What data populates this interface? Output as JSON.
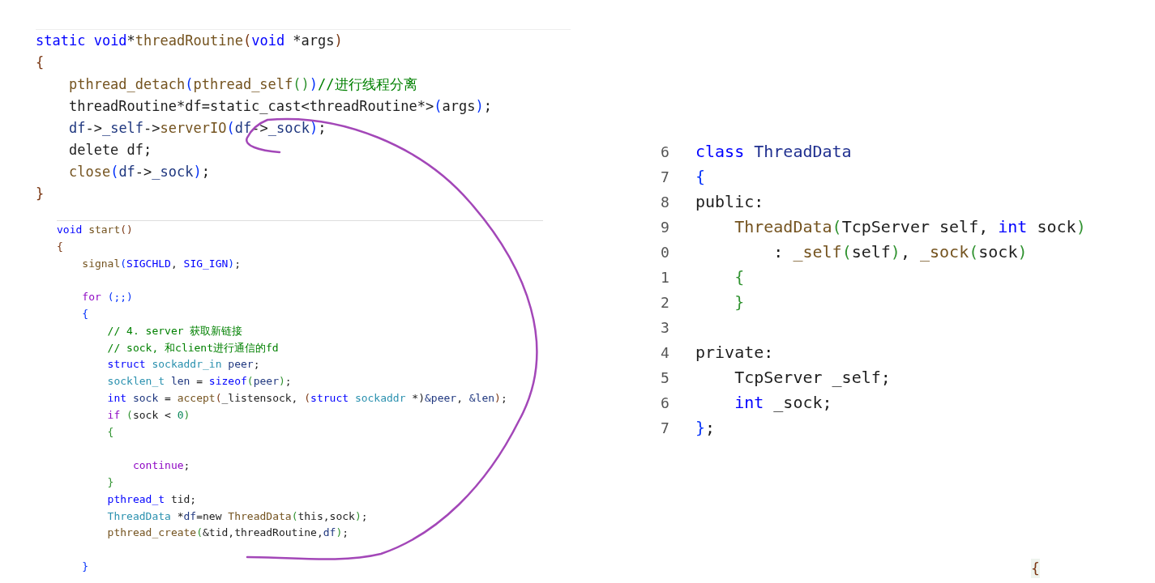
{
  "snippets": [
    {
      "lines": [
        {
          "kind": "code",
          "tokens": [
            {
              "text": "static ",
              "kind": "kw"
            },
            {
              "text": "void",
              "kind": "kw"
            },
            {
              "text": "*",
              "kind": "txt"
            },
            {
              "text": "threadRoutine",
              "kind": "fn"
            },
            {
              "text": "(",
              "kind": "p1"
            },
            {
              "text": "void ",
              "kind": "kw"
            },
            {
              "text": "*args",
              "kind": "txt"
            },
            {
              "text": ")",
              "kind": "p1"
            }
          ]
        },
        {
          "kind": "code",
          "tokens": [
            {
              "text": "{",
              "kind": "p1"
            }
          ]
        },
        {
          "kind": "code",
          "tokens": [
            {
              "text": "    pthread_detach",
              "kind": "fn"
            },
            {
              "text": "(",
              "kind": "p2"
            },
            {
              "text": "pthread_self",
              "kind": "fn"
            },
            {
              "text": "()",
              "kind": "p3"
            },
            {
              "text": ")",
              "kind": "p2"
            },
            {
              "text": "//进行线程分离",
              "kind": "cmt"
            }
          ]
        },
        {
          "kind": "code",
          "tokens": [
            {
              "text": "    threadRoutine*df=static_cast<threadRoutine*>",
              "kind": "txt"
            },
            {
              "text": "(",
              "kind": "p2"
            },
            {
              "text": "args",
              "kind": "txt"
            },
            {
              "text": ")",
              "kind": "p2"
            },
            {
              "text": ";",
              "kind": "txt"
            }
          ]
        },
        {
          "kind": "code",
          "tokens": [
            {
              "text": "    df",
              "kind": "var"
            },
            {
              "text": "->",
              "kind": "txt"
            },
            {
              "text": "_self",
              "kind": "var"
            },
            {
              "text": "->",
              "kind": "txt"
            },
            {
              "text": "serverIO",
              "kind": "fn"
            },
            {
              "text": "(",
              "kind": "p2"
            },
            {
              "text": "df",
              "kind": "var"
            },
            {
              "text": "->",
              "kind": "txt"
            },
            {
              "text": "_sock",
              "kind": "var"
            },
            {
              "text": ")",
              "kind": "p2"
            },
            {
              "text": ";",
              "kind": "txt"
            }
          ]
        },
        {
          "kind": "code",
          "tokens": [
            {
              "text": "    delete df;",
              "kind": "txt"
            }
          ]
        },
        {
          "kind": "code",
          "tokens": [
            {
              "text": "    close",
              "kind": "fn"
            },
            {
              "text": "(",
              "kind": "p2"
            },
            {
              "text": "df",
              "kind": "var"
            },
            {
              "text": "->",
              "kind": "txt"
            },
            {
              "text": "_sock",
              "kind": "var"
            },
            {
              "text": ")",
              "kind": "p2"
            },
            {
              "text": ";",
              "kind": "txt"
            }
          ]
        },
        {
          "kind": "code",
          "tokens": [
            {
              "text": "}",
              "kind": "p1"
            }
          ]
        }
      ]
    },
    {
      "lines": [
        {
          "kind": "code",
          "tokens": [
            {
              "text": "void ",
              "kind": "kw"
            },
            {
              "text": "start",
              "kind": "fn"
            },
            {
              "text": "()",
              "kind": "p1"
            }
          ]
        },
        {
          "kind": "code",
          "tokens": [
            {
              "text": "{",
              "kind": "p1"
            }
          ]
        },
        {
          "kind": "code",
          "tokens": [
            {
              "text": "    signal",
              "kind": "fn"
            },
            {
              "text": "(",
              "kind": "p2"
            },
            {
              "text": "SIGCHLD",
              "kind": "kw"
            },
            {
              "text": ", ",
              "kind": "txt"
            },
            {
              "text": "SIG_IGN",
              "kind": "kw"
            },
            {
              "text": ")",
              "kind": "p2"
            },
            {
              "text": ";",
              "kind": "txt"
            }
          ]
        },
        {
          "kind": "blank"
        },
        {
          "kind": "code",
          "tokens": [
            {
              "text": "    for ",
              "kind": "ctrl"
            },
            {
              "text": "(;;)",
              "kind": "p2"
            }
          ]
        },
        {
          "kind": "code",
          "tokens": [
            {
              "text": "    {",
              "kind": "p2"
            }
          ]
        },
        {
          "kind": "code",
          "tokens": [
            {
              "text": "        // 4. server 获取新链接",
              "kind": "cmt"
            }
          ]
        },
        {
          "kind": "code",
          "tokens": [
            {
              "text": "        // sock, 和client进行通信的fd",
              "kind": "cmt"
            }
          ]
        },
        {
          "kind": "code",
          "tokens": [
            {
              "text": "        struct ",
              "kind": "kw"
            },
            {
              "text": "sockaddr_in ",
              "kind": "teal"
            },
            {
              "text": "peer",
              "kind": "var"
            },
            {
              "text": ";",
              "kind": "txt"
            }
          ]
        },
        {
          "kind": "code",
          "tokens": [
            {
              "text": "        socklen_t ",
              "kind": "teal"
            },
            {
              "text": "len",
              "kind": "var"
            },
            {
              "text": " = ",
              "kind": "txt"
            },
            {
              "text": "sizeof",
              "kind": "kw"
            },
            {
              "text": "(",
              "kind": "p3"
            },
            {
              "text": "peer",
              "kind": "var"
            },
            {
              "text": ")",
              "kind": "p3"
            },
            {
              "text": ";",
              "kind": "txt"
            }
          ]
        },
        {
          "kind": "code",
          "tokens": [
            {
              "text": "        int ",
              "kind": "kw"
            },
            {
              "text": "sock",
              "kind": "var"
            },
            {
              "text": " = ",
              "kind": "txt"
            },
            {
              "text": "accept",
              "kind": "fn"
            },
            {
              "text": "(",
              "kind": "p1"
            },
            {
              "text": "_listensock, ",
              "kind": "txt"
            },
            {
              "text": "(",
              "kind": "p1"
            },
            {
              "text": "struct ",
              "kind": "kw"
            },
            {
              "text": "sockaddr ",
              "kind": "teal"
            },
            {
              "text": "*)",
              "kind": "txt"
            },
            {
              "text": "&peer",
              "kind": "var"
            },
            {
              "text": ", ",
              "kind": "txt"
            },
            {
              "text": "&len",
              "kind": "var"
            },
            {
              "text": ")",
              "kind": "p1"
            },
            {
              "text": ";",
              "kind": "txt"
            }
          ]
        },
        {
          "kind": "code",
          "tokens": [
            {
              "text": "        if ",
              "kind": "ctrl"
            },
            {
              "text": "(",
              "kind": "p3"
            },
            {
              "text": "sock < ",
              "kind": "txt"
            },
            {
              "text": "0",
              "kind": "num"
            },
            {
              "text": ")",
              "kind": "p3"
            }
          ]
        },
        {
          "kind": "code",
          "tokens": [
            {
              "text": "        {",
              "kind": "p3"
            }
          ]
        },
        {
          "kind": "blank"
        },
        {
          "kind": "code",
          "tokens": [
            {
              "text": "            continue",
              "kind": "ctrl"
            },
            {
              "text": ";",
              "kind": "txt"
            }
          ]
        },
        {
          "kind": "code",
          "tokens": [
            {
              "text": "        }",
              "kind": "p3"
            }
          ]
        },
        {
          "kind": "code",
          "tokens": [
            {
              "text": "        pthread_t ",
              "kind": "kw"
            },
            {
              "text": "tid;",
              "kind": "txt"
            }
          ]
        },
        {
          "kind": "code",
          "tokens": [
            {
              "text": "        ThreadData ",
              "kind": "teal"
            },
            {
              "text": "*",
              "kind": "txt"
            },
            {
              "text": "df",
              "kind": "var"
            },
            {
              "text": "=new ",
              "kind": "txt"
            },
            {
              "text": "ThreadData",
              "kind": "fn"
            },
            {
              "text": "(",
              "kind": "p3"
            },
            {
              "text": "this,sock",
              "kind": "txt"
            },
            {
              "text": ")",
              "kind": "p3"
            },
            {
              "text": ";",
              "kind": "txt"
            }
          ]
        },
        {
          "kind": "code",
          "tokens": [
            {
              "text": "        pthread_create",
              "kind": "fn"
            },
            {
              "text": "(",
              "kind": "p3"
            },
            {
              "text": "&tid,threadRoutine,",
              "kind": "txt"
            },
            {
              "text": "df",
              "kind": "var"
            },
            {
              "text": ")",
              "kind": "p3"
            },
            {
              "text": ";",
              "kind": "txt"
            }
          ]
        },
        {
          "kind": "blank"
        },
        {
          "kind": "code",
          "tokens": [
            {
              "text": "    }",
              "kind": "p2"
            }
          ]
        }
      ]
    },
    {
      "lines": [
        {
          "kind": "code",
          "number": "6",
          "tokens": [
            {
              "text": "class ",
              "kind": "kw"
            },
            {
              "text": "ThreadData",
              "kind": "type"
            }
          ]
        },
        {
          "kind": "code",
          "number": "7",
          "tokens": [
            {
              "text": "{",
              "kind": "p2"
            }
          ]
        },
        {
          "kind": "code",
          "number": "8",
          "tokens": [
            {
              "text": "public:",
              "kind": "txt"
            }
          ]
        },
        {
          "kind": "code",
          "number": "9",
          "tokens": [
            {
              "text": "    ThreadData",
              "kind": "fn"
            },
            {
              "text": "(",
              "kind": "p3"
            },
            {
              "text": "TcpServer self, ",
              "kind": "txt"
            },
            {
              "text": "int ",
              "kind": "kw"
            },
            {
              "text": "sock",
              "kind": "txt"
            },
            {
              "text": ")",
              "kind": "p3"
            }
          ]
        },
        {
          "kind": "code",
          "number": "0",
          "tokens": [
            {
              "text": "        : ",
              "kind": "txt"
            },
            {
              "text": "_self",
              "kind": "fn"
            },
            {
              "text": "(",
              "kind": "p3"
            },
            {
              "text": "self",
              "kind": "txt"
            },
            {
              "text": ")",
              "kind": "p3"
            },
            {
              "text": ", ",
              "kind": "txt"
            },
            {
              "text": "_sock",
              "kind": "fn"
            },
            {
              "text": "(",
              "kind": "p3"
            },
            {
              "text": "sock",
              "kind": "txt"
            },
            {
              "text": ")",
              "kind": "p3"
            }
          ]
        },
        {
          "kind": "code",
          "number": "1",
          "tokens": [
            {
              "text": "    {",
              "kind": "p3"
            }
          ]
        },
        {
          "kind": "code",
          "number": "2",
          "tokens": [
            {
              "text": "    }",
              "kind": "p3"
            }
          ]
        },
        {
          "kind": "blank",
          "number": "3"
        },
        {
          "kind": "code",
          "number": "4",
          "tokens": [
            {
              "text": "private:",
              "kind": "txt"
            }
          ]
        },
        {
          "kind": "code",
          "number": "5",
          "tokens": [
            {
              "text": "    TcpServer _self;",
              "kind": "txt"
            }
          ]
        },
        {
          "kind": "code",
          "number": "6",
          "tokens": [
            {
              "text": "    int ",
              "kind": "kw"
            },
            {
              "text": "_sock;",
              "kind": "txt"
            }
          ]
        },
        {
          "kind": "code",
          "number": "7",
          "tokens": [
            {
              "text": "}",
              "kind": "p2"
            },
            {
              "text": ";",
              "kind": "txt"
            }
          ]
        }
      ]
    },
    {
      "lines": [
        {
          "kind": "code",
          "tokens": [
            {
              "text": "{",
              "kind": "p1"
            }
          ]
        }
      ]
    }
  ]
}
